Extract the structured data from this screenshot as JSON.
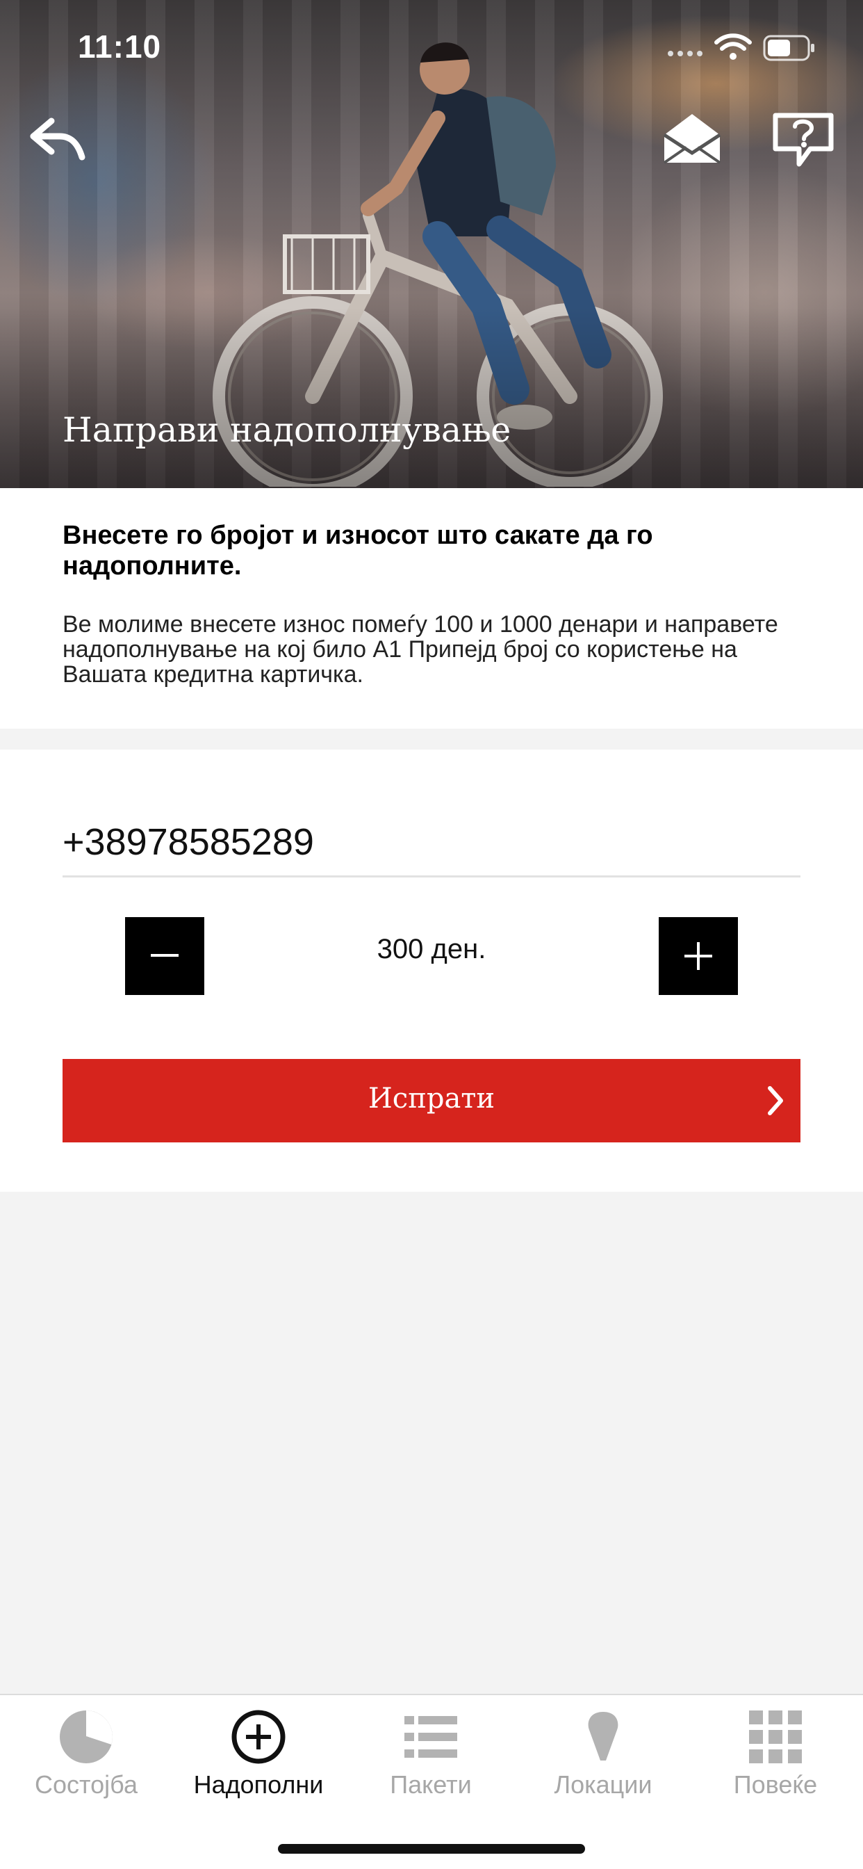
{
  "status_bar": {
    "time": "11:10"
  },
  "hero": {
    "title": "Направи надополнување"
  },
  "info": {
    "heading": "Внесете го бројот и износот што сакате да го надополните.",
    "description": "Ве молиме внесете износ помеѓу 100 и 1000 денари и направете надополнување на кој било А1 Припејд број со користење на Вашата кредитна картичка."
  },
  "form": {
    "phone_value": "+38978585289",
    "amount": "300 ден.",
    "submit_label": "Испрати"
  },
  "tabs": [
    {
      "label": "Состојба",
      "icon": "pie-chart-icon",
      "active": false
    },
    {
      "label": "Надополни",
      "icon": "plus-circle-icon",
      "active": true
    },
    {
      "label": "Пакети",
      "icon": "list-icon",
      "active": false
    },
    {
      "label": "Локации",
      "icon": "location-pin-icon",
      "active": false
    },
    {
      "label": "Повеќе",
      "icon": "grid-icon",
      "active": false
    }
  ],
  "colors": {
    "accent": "#d6241d",
    "tab_inactive": "#a7a7a7",
    "tab_active": "#111111"
  }
}
